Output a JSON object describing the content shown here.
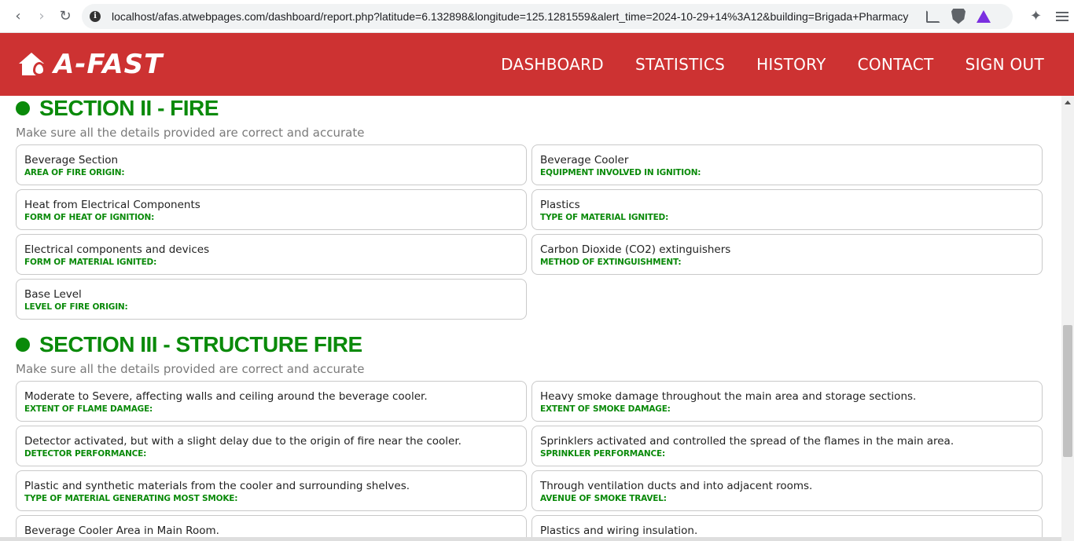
{
  "browser": {
    "url": "localhost/afas.atwebpages.com/dashboard/report.php?latitude=6.132898&longitude=125.1281559&alert_time=2024-10-29+14%3A12&building=Brigada+Pharmacy"
  },
  "header": {
    "brand": "A-FAST",
    "nav": [
      "DASHBOARD",
      "STATISTICS",
      "HISTORY",
      "CONTACT",
      "SIGN OUT"
    ]
  },
  "section2": {
    "title": "SECTION II - FIRE",
    "subtitle": "Make sure all the details provided are correct and accurate",
    "fields": [
      {
        "value": "Beverage Section",
        "label": "AREA OF FIRE ORIGIN:"
      },
      {
        "value": "Beverage Cooler",
        "label": "EQUIPMENT INVOLVED IN IGNITION:"
      },
      {
        "value": "Heat from Electrical Components",
        "label": "FORM OF HEAT OF IGNITION:"
      },
      {
        "value": "Plastics",
        "label": "TYPE OF MATERIAL IGNITED:"
      },
      {
        "value": "Electrical components and devices",
        "label": "FORM OF MATERIAL IGNITED:"
      },
      {
        "value": "Carbon Dioxide (CO2) extinguishers",
        "label": "METHOD OF EXTINGUISHMENT:"
      },
      {
        "value": "Base Level",
        "label": "LEVEL OF FIRE ORIGIN:"
      }
    ]
  },
  "section3": {
    "title": "SECTION III - STRUCTURE FIRE",
    "subtitle": "Make sure all the details provided are correct and accurate",
    "fields": [
      {
        "value": "Moderate to Severe, affecting walls and ceiling around the beverage cooler.",
        "label": "EXTENT OF FLAME DAMAGE:"
      },
      {
        "value": "Heavy smoke damage throughout the main area and storage sections.",
        "label": "EXTENT OF SMOKE DAMAGE:"
      },
      {
        "value": "Detector activated, but with a slight delay due to the origin of fire near the cooler.",
        "label": "DETECTOR PERFORMANCE:"
      },
      {
        "value": "Sprinklers activated and controlled the spread of the flames in the main area.",
        "label": "SPRINKLER PERFORMANCE:"
      },
      {
        "value": "Plastic and synthetic materials from the cooler and surrounding shelves.",
        "label": "TYPE OF MATERIAL GENERATING MOST SMOKE:"
      },
      {
        "value": "Through ventilation ducts and into adjacent rooms.",
        "label": "AVENUE OF SMOKE TRAVEL:"
      },
      {
        "value": "Beverage Cooler Area in Main Room.",
        "label": ""
      },
      {
        "value": "Plastics and wiring insulation.",
        "label": ""
      }
    ]
  }
}
